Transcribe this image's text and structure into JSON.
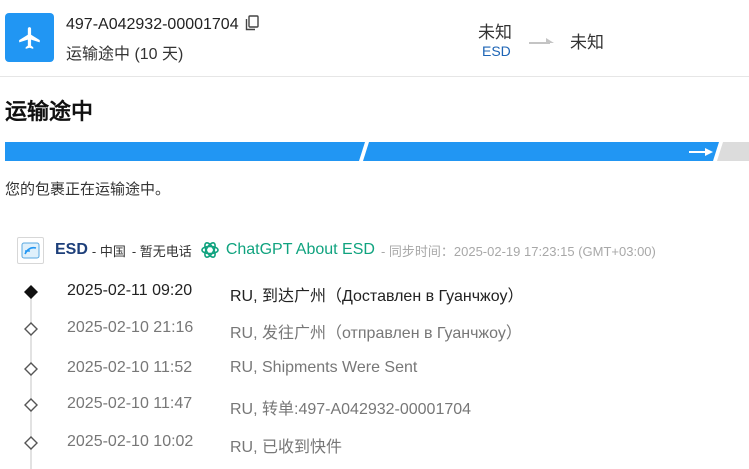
{
  "shipment": {
    "tracking_number": "497-A042932-00001704",
    "transit_days": "运输途中 (10 天)",
    "origin": "未知",
    "origin_carrier": "ESD",
    "destination": "未知"
  },
  "status": {
    "title": "运输途中",
    "description": "您的包裹正在运输途中。",
    "progress_stage": 3,
    "progress_total": 4,
    "colors": {
      "active": "#2196f3",
      "inactive": "#dcdcdc"
    }
  },
  "carrier": {
    "name": "ESD",
    "country": "- 中国",
    "phone": "- 暂无电话",
    "chatgpt_label": "ChatGPT About ESD",
    "sync_time": "- 同步时间：2025-02-19 17:23:15 (GMT+03:00)"
  },
  "events": [
    {
      "time": "2025-02-11 09:20",
      "text": "RU, 到达广州（Доставлен в Гуанчжоу）",
      "latest": true
    },
    {
      "time": "2025-02-10 21:16",
      "text": "RU, 发往广州（отправлен в Гуанчжоу）",
      "latest": false
    },
    {
      "time": "2025-02-10 11:52",
      "text": "RU, Shipments Were Sent",
      "latest": false
    },
    {
      "time": "2025-02-10 11:47",
      "text": "RU, 转单:497-A042932-00001704",
      "latest": false
    },
    {
      "time": "2025-02-10 10:02",
      "text": "RU, 已收到快件",
      "latest": false
    }
  ]
}
